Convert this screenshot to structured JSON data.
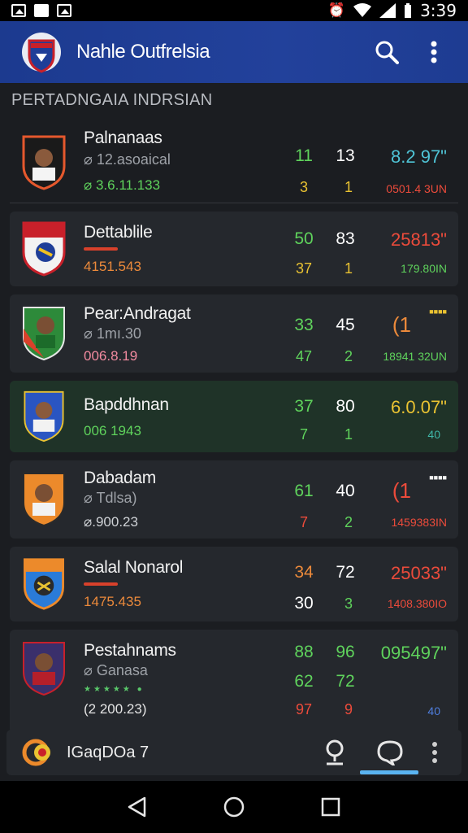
{
  "status_bar": {
    "time": "3:39"
  },
  "app_bar": {
    "title": "Nahle Outfrelsia"
  },
  "section": {
    "title": "PERTADNGAIA INDRSIAN"
  },
  "colors": {
    "app_bar": "#22419b",
    "green": "#5fd35c",
    "yellow": "#e9c232",
    "red": "#ec4b3b",
    "cyan": "#4fc4d6",
    "accent_blue": "#5ab3f0"
  },
  "teams": [
    {
      "name": "Palnanaas",
      "subtitle": "⌀ 12.asoaical",
      "meta": "⌀ 3.6.11.133",
      "meta_color": "#5fd35c",
      "a1": "11",
      "a1_color": "#5fd35c",
      "b1": "13",
      "b1_color": "#ffffff",
      "a2": "3",
      "a2_color": "#e9c232",
      "b2": "1",
      "b2_color": "#e9c232",
      "v1": "8.2 97\"",
      "v1_color": "#4fc4d6",
      "v2": "0501.4 3UN",
      "v2_color": "#ec4b3b"
    },
    {
      "name": "Dettablile",
      "subtitle": "",
      "meta": "4151.543",
      "meta_color": "#ec8a3b",
      "a1": "50",
      "a1_color": "#5fd35c",
      "b1": "83",
      "b1_color": "#ffffff",
      "a2": "37",
      "a2_color": "#e9c232",
      "b2": "1",
      "b2_color": "#e9c232",
      "v1": "25813\"",
      "v1_color": "#ec4b3b",
      "v2": "179.80IN",
      "v2_color": "#5fd35c"
    },
    {
      "name": "Pear:Andragat",
      "subtitle": "⌀ 1mı.30",
      "meta": "006.8.19",
      "meta_color": "#f38ba0",
      "a1": "33",
      "a1_color": "#5fd35c",
      "b1": "45",
      "b1_color": "#ffffff",
      "a2": "47",
      "a2_color": "#5fd35c",
      "b2": "2",
      "b2_color": "#5fd35c",
      "v1": "(1",
      "v1_color": "#ec8a3b",
      "v1b": "■■■■",
      "v2": "18941 32UN",
      "v2_color": "#5fd35c"
    },
    {
      "name": "Bapddhnan",
      "subtitle": "",
      "meta": "006 1943",
      "meta_color": "#5fd35c",
      "a1": "37",
      "a1_color": "#5fd35c",
      "b1": "80",
      "b1_color": "#ffffff",
      "a2": "7",
      "a2_color": "#5fd35c",
      "b2": "1",
      "b2_color": "#5fd35c",
      "v1": "6.0.07\"",
      "v1_color": "#e9c232",
      "v2": "40",
      "v2_color": "#3fb7a8"
    },
    {
      "name": "Dabadam",
      "subtitle": "⌀ Tdlsa)",
      "meta": "⌀.900.23",
      "meta_color": "#cfd2d6",
      "a1": "61",
      "a1_color": "#5fd35c",
      "b1": "40",
      "b1_color": "#ffffff",
      "a2": "7",
      "a2_color": "#ec4b3b",
      "b2": "2",
      "b2_color": "#5fd35c",
      "v1": "(1",
      "v1_color": "#ec4b3b",
      "v1b": "■■■■",
      "v2": "1459383IN",
      "v2_color": "#ec4b3b"
    },
    {
      "name": "Salal Nonarol",
      "subtitle": "",
      "meta": "1475.435",
      "meta_color": "#ec8a3b",
      "a1": "34",
      "a1_color": "#ec8a3b",
      "b1": "72",
      "b1_color": "#ffffff",
      "a2": "30",
      "a2_color": "#ffffff",
      "b2": "3",
      "b2_color": "#5fd35c",
      "v1": "25033\"",
      "v1_color": "#ec4b3b",
      "v2": "1408.380IO",
      "v2_color": "#ec4b3b"
    },
    {
      "name": "Pestahnams",
      "subtitle": "⌀ Ganasa",
      "meta": "(2 200.23)",
      "meta_color": "#e4e4e4",
      "a1": "88",
      "a1_color": "#5fd35c",
      "b1": "96",
      "b1_color": "#5fd35c",
      "a2": "62",
      "a2_color": "#5fd35c",
      "b2": "72",
      "b2_color": "#5fd35c",
      "a3": "97",
      "a3_color": "#ec4b3b",
      "b3": "9",
      "b3_color": "#ec4b3b",
      "v1": "095497\"",
      "v1_color": "#5fd35c",
      "v2": "40",
      "v2_color": "#4f7fe0"
    }
  ],
  "bottom_bar": {
    "label": "IGaqDOa⁠ 7"
  }
}
